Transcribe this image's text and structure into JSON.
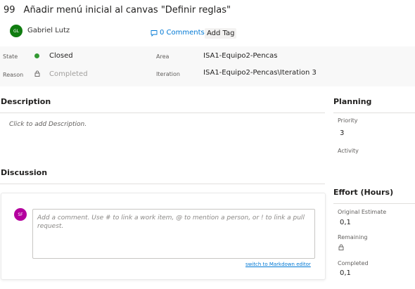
{
  "work_item": {
    "id": "99",
    "title": "Añadir menú inicial al canvas \"Definir reglas\""
  },
  "assignee": {
    "initials": "GL",
    "name": "Gabriel Lutz",
    "avatar_color": "#107c10"
  },
  "header_actions": {
    "comments_label": "0 Comments",
    "add_tag_label": "Add Tag"
  },
  "fields": {
    "state": {
      "label": "State",
      "value": "Closed",
      "dot_color": "#339933"
    },
    "reason": {
      "label": "Reason",
      "value": "Completed"
    },
    "area": {
      "label": "Area",
      "value": "ISA1-Equipo2-Pencas"
    },
    "iteration": {
      "label": "Iteration",
      "value": "ISA1-Equipo2-Pencas\\Iteration 3"
    }
  },
  "description": {
    "title": "Description",
    "placeholder": "Click to add Description."
  },
  "discussion": {
    "title": "Discussion",
    "commenter_initials": "SF",
    "commenter_color": "#b4009e",
    "comment_placeholder": "Add a comment. Use # to link a work item, @ to mention a person, or ! to link a pull request.",
    "markdown_link": "switch to Markdown editor"
  },
  "planning": {
    "title": "Planning",
    "priority_label": "Priority",
    "priority_value": "3",
    "activity_label": "Activity",
    "activity_value": ""
  },
  "effort": {
    "title": "Effort (Hours)",
    "original_estimate_label": "Original Estimate",
    "original_estimate_value": "0,1",
    "remaining_label": "Remaining",
    "completed_label": "Completed",
    "completed_value": "0,1"
  }
}
